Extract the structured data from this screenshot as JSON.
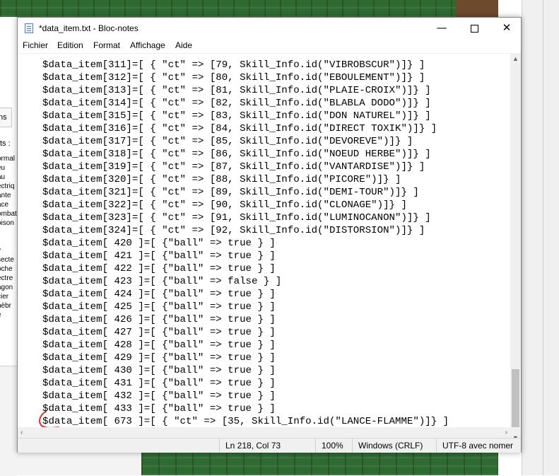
{
  "window": {
    "title": "*data_item.txt - Bloc-notes",
    "controls": {
      "minimize": "—",
      "maximize": "",
      "close": "✕"
    }
  },
  "menu": [
    "Fichier",
    "Edition",
    "Format",
    "Affichage",
    "Aide"
  ],
  "lines": [
    "$data_item[311]=[ { \"ct\" => [79, Skill_Info.id(\"VIBROBSCUR\")]} ]",
    "$data_item[312]=[ { \"ct\" => [80, Skill_Info.id(\"EBOULEMENT\")]} ]",
    "$data_item[313]=[ { \"ct\" => [81, Skill_Info.id(\"PLAIE-CROIX\")]} ]",
    "$data_item[314]=[ { \"ct\" => [82, Skill_Info.id(\"BLABLA DODO\")]} ]",
    "$data_item[315]=[ { \"ct\" => [83, Skill_Info.id(\"DON NATUREL\")]} ]",
    "$data_item[316]=[ { \"ct\" => [84, Skill_Info.id(\"DIRECT TOXIK\")]} ]",
    "$data_item[317]=[ { \"ct\" => [85, Skill_Info.id(\"DEVOREVE\")]} ]",
    "$data_item[318]=[ { \"ct\" => [86, Skill_Info.id(\"NOEUD HERBE\")]} ]",
    "$data_item[319]=[ { \"ct\" => [87, Skill_Info.id(\"VANTARDISE\")]} ]",
    "$data_item[320]=[ { \"ct\" => [88, Skill_Info.id(\"PICORE\")]} ]",
    "$data_item[321]=[ { \"ct\" => [89, Skill_Info.id(\"DEMI-TOUR\")]} ]",
    "$data_item[322]=[ { \"ct\" => [90, Skill_Info.id(\"CLONAGE\")]} ]",
    "$data_item[323]=[ { \"ct\" => [91, Skill_Info.id(\"LUMINOCANON\")]} ]",
    "$data_item[324]=[ { \"ct\" => [92, Skill_Info.id(\"DISTORSION\")]} ]",
    "$data_item[ 420 ]=[ {\"ball\" => true } ]",
    "$data_item[ 421 ]=[ {\"ball\" => true } ]",
    "$data_item[ 422 ]=[ {\"ball\" => true } ]",
    "$data_item[ 423 ]=[ {\"ball\" => false } ]",
    "$data_item[ 424 ]=[ {\"ball\" => true } ]",
    "$data_item[ 425 ]=[ {\"ball\" => true } ]",
    "$data_item[ 426 ]=[ {\"ball\" => true } ]",
    "$data_item[ 427 ]=[ {\"ball\" => true } ]",
    "$data_item[ 428 ]=[ {\"ball\" => true } ]",
    "$data_item[ 429 ]=[ {\"ball\" => true } ]",
    "$data_item[ 430 ]=[ {\"ball\" => true } ]",
    "$data_item[ 431 ]=[ {\"ball\" => true } ]",
    "$data_item[ 432 ]=[ {\"ball\" => true } ]",
    "$data_item[ 433 ]=[ {\"ball\" => true } ]",
    "$data_item[ 673 ]=[ { \"ct\" => [35, Skill_Info.id(\"LANCE-FLAMME\")]} ]"
  ],
  "scroll": {
    "up": "▲",
    "down": "▼",
    "left": "‹",
    "right": "›"
  },
  "statusbar": {
    "position": "Ln 218, Col 73",
    "zoom": "100%",
    "line_ending": "Windows (CRLF)",
    "encoding": "UTF-8 avec nomer"
  },
  "background": {
    "left_tab": "ns",
    "left_label": "ts :",
    "left_list": [
      "ormal",
      "eu",
      "au",
      "ectriq",
      "ante",
      "ace",
      "ombat",
      "oison",
      "l",
      "l",
      "y",
      "secte",
      "oche",
      "ectre",
      "agon",
      "cier",
      "nèbr",
      "e"
    ]
  },
  "colors": {
    "annotation": "#d9322e",
    "game_green": "#2f6a32"
  }
}
